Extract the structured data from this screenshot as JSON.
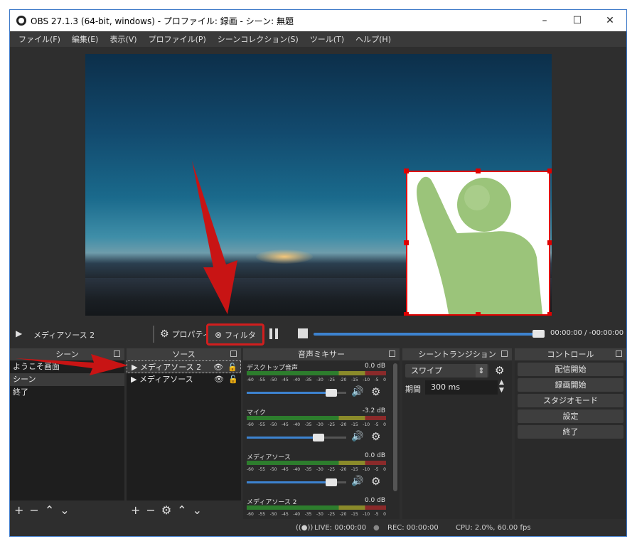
{
  "window": {
    "title": "OBS 27.1.3 (64-bit, windows) - プロファイル: 録画 - シーン: 無題"
  },
  "titlebar_buttons": {
    "minimize": "–",
    "maximize": "☐",
    "close": "✕"
  },
  "menu": [
    "ファイル(F)",
    "編集(E)",
    "表示(V)",
    "プロファイル(P)",
    "シーンコレクション(S)",
    "ツール(T)",
    "ヘルプ(H)"
  ],
  "transport": {
    "play_icon": "▶",
    "source_name": "メディアソース 2",
    "properties_label": "プロパティ",
    "filter_label": "フィルタ",
    "time": "00:00:00  /  -00:00:00"
  },
  "scenes": {
    "header": "シーン",
    "items": [
      "ようこそ画面",
      "シーン",
      "終了"
    ]
  },
  "sources": {
    "header": "ソース",
    "items": [
      "メディアソース 2",
      "メディアソース"
    ]
  },
  "mixer": {
    "header": "音声ミキサー",
    "channels": [
      {
        "name": "デスクトップ音声",
        "db": "0.0 dB",
        "volume": 0.85
      },
      {
        "name": "マイク",
        "db": "-3.2 dB",
        "volume": 0.72
      },
      {
        "name": "メディアソース",
        "db": "0.0 dB",
        "volume": 0.85
      },
      {
        "name": "メディアソース 2",
        "db": "0.0 dB",
        "volume": 0.85
      }
    ],
    "ticks": [
      "-60",
      "-55",
      "-50",
      "-45",
      "-40",
      "-35",
      "-30",
      "-25",
      "-20",
      "-15",
      "-10",
      "-5",
      "0"
    ]
  },
  "transitions": {
    "header": "シーントランジション",
    "selected": "スワイプ",
    "duration_label": "期間",
    "duration_value": "300 ms"
  },
  "controls": {
    "header": "コントロール",
    "buttons": [
      "配信開始",
      "録画開始",
      "スタジオモード",
      "設定",
      "終了"
    ]
  },
  "status": {
    "live": "LIVE: 00:00:00",
    "rec": "REC: 00:00:00",
    "cpu": "CPU: 2.0%, 60.00 fps"
  },
  "colors": {
    "accent": "#3d83d0",
    "highlight": "#d21e1e",
    "figure": "#9bc47a"
  }
}
